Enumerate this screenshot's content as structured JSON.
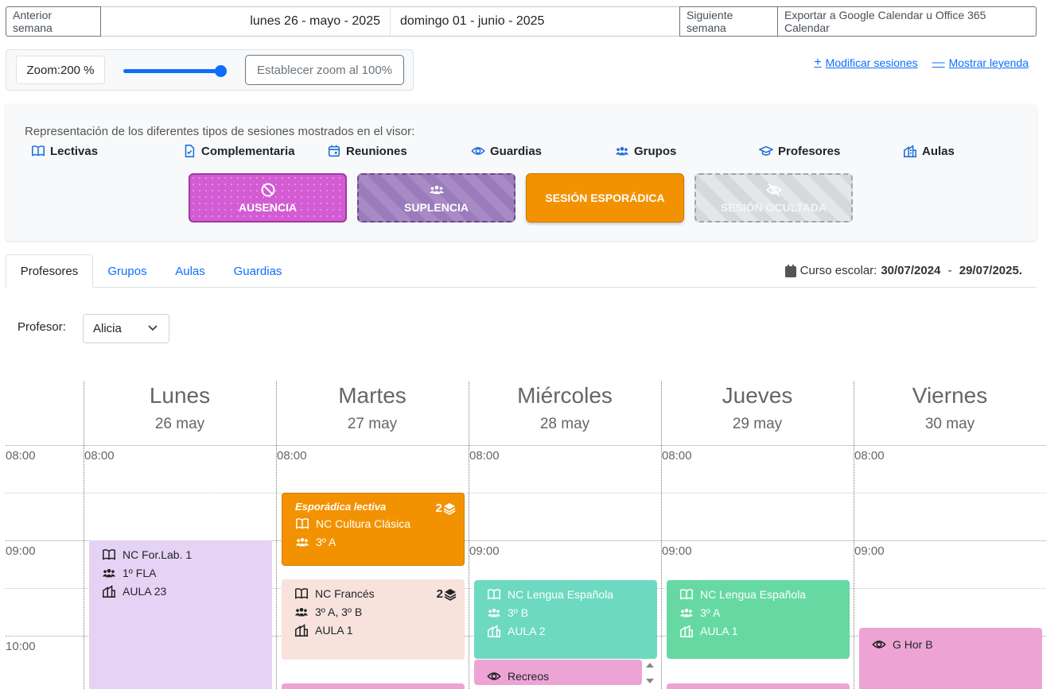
{
  "topbar": {
    "prev_label": "Anterior semana",
    "start_date": "lunes 26 - mayo - 2025",
    "end_date": "domingo 01 - junio - 2025",
    "next_label": "Siguiente semana",
    "export_label": "Exportar a Google Calendar u Office 365 Calendar"
  },
  "zoom": {
    "label": "Zoom:200 %",
    "value_percent": 200,
    "reset_label": "Establecer zoom al 100%"
  },
  "links": {
    "modify_sessions": "Modificar sesiones",
    "show_legend": "Mostrar leyenda"
  },
  "legend": {
    "caption": "Representación de los diferentes tipos de sesiones mostrados en el visor:",
    "types": [
      {
        "label": "Lectivas",
        "icon": "book-icon"
      },
      {
        "label": "Complementaria",
        "icon": "file-check-icon"
      },
      {
        "label": "Reuniones",
        "icon": "calendar-icon"
      },
      {
        "label": "Guardias",
        "icon": "eye-icon"
      },
      {
        "label": "Grupos",
        "icon": "users-icon"
      },
      {
        "label": "Profesores",
        "icon": "graduation-cap-icon"
      },
      {
        "label": "Aulas",
        "icon": "building-icon"
      }
    ],
    "cards": {
      "ausencia": "Ausencia",
      "suplencia": "Suplencia",
      "esporadica": "Sesión esporádica",
      "oculta": "Sesión ocultada"
    },
    "colors": {
      "ausencia": "#d35bd3",
      "suplencia": "#9b7bbb",
      "esporadica": "#f39200",
      "oculta": "#d6d9dc"
    }
  },
  "tabs": [
    "Profesores",
    "Grupos",
    "Aulas",
    "Guardias"
  ],
  "curso": {
    "label": "Curso escolar:",
    "start": "30/07/2024",
    "separator": " - ",
    "end": "29/07/2025."
  },
  "profesor": {
    "label": "Profesor:",
    "selected": "Alicia"
  },
  "calendar": {
    "days": [
      {
        "name": "Lunes",
        "date": "26 may"
      },
      {
        "name": "Martes",
        "date": "27 may"
      },
      {
        "name": "Miércoles",
        "date": "28 may"
      },
      {
        "name": "Jueves",
        "date": "29 may"
      },
      {
        "name": "Viernes",
        "date": "30 may"
      }
    ],
    "hours": [
      "08:00",
      "09:00",
      "10:00"
    ],
    "events": {
      "lun_forlab": {
        "subject": "NC For.Lab. 1",
        "group": "1º FLA",
        "room": "AULA 23",
        "color": "#e6d2f5"
      },
      "mar_esporadica": {
        "title": "Esporádica lectiva",
        "count": "2",
        "subject": "NC Cultura Clásica",
        "group": "3º A",
        "color": "#f39200"
      },
      "mar_frances": {
        "count": "2",
        "subject": "NC Francés",
        "group": "3º A, 3º B",
        "room": "AULA 1",
        "color": "#f7e2dc"
      },
      "mie_lengua": {
        "subject": "NC Lengua Española",
        "group": "3º B",
        "room": "AULA 2",
        "color": "#6dd9c0"
      },
      "mie_recreos": {
        "subject": "Recreos",
        "color": "#eda4d4"
      },
      "jue_lengua": {
        "subject": "NC Lengua Española",
        "group": "3º A",
        "room": "AULA 1",
        "color": "#66d9a3"
      },
      "vie_guardia": {
        "subject": "G Hor B",
        "color": "#eda4d4"
      }
    }
  }
}
